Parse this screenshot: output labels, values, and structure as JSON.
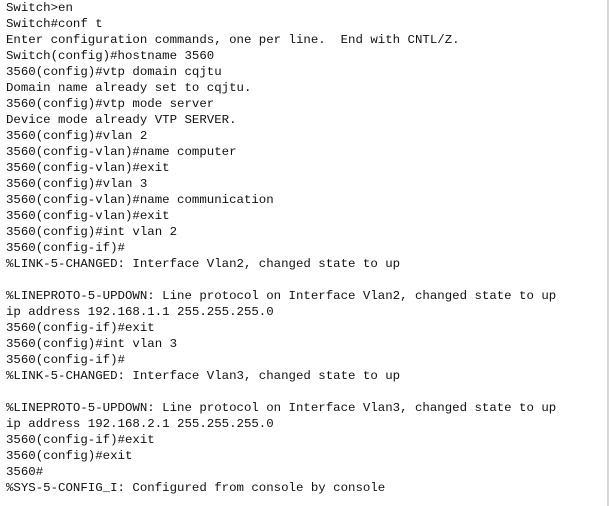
{
  "terminal": {
    "lines": [
      "Switch>en",
      "Switch#conf t",
      "Enter configuration commands, one per line.  End with CNTL/Z.",
      "Switch(config)#hostname 3560",
      "3560(config)#vtp domain cqjtu",
      "Domain name already set to cqjtu.",
      "3560(config)#vtp mode server",
      "Device mode already VTP SERVER.",
      "3560(config)#vlan 2",
      "3560(config-vlan)#name computer",
      "3560(config-vlan)#exit",
      "3560(config)#vlan 3",
      "3560(config-vlan)#name communication",
      "3560(config-vlan)#exit",
      "3560(config)#int vlan 2",
      "3560(config-if)#",
      "%LINK-5-CHANGED: Interface Vlan2, changed state to up",
      "",
      "%LINEPROTO-5-UPDOWN: Line protocol on Interface Vlan2, changed state to up",
      "ip address 192.168.1.1 255.255.255.0",
      "3560(config-if)#exit",
      "3560(config)#int vlan 3",
      "3560(config-if)#",
      "%LINK-5-CHANGED: Interface Vlan3, changed state to up",
      "",
      "%LINEPROTO-5-UPDOWN: Line protocol on Interface Vlan3, changed state to up",
      "ip address 192.168.2.1 255.255.255.0",
      "3560(config-if)#exit",
      "3560(config)#exit",
      "3560#",
      "%SYS-5-CONFIG_I: Configured from console by console"
    ]
  }
}
